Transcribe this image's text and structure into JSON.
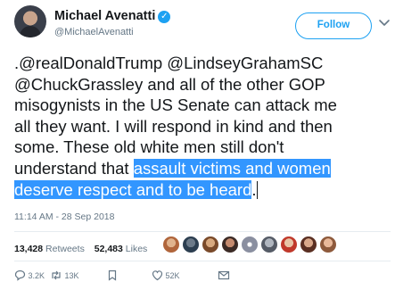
{
  "tweet": {
    "author": {
      "display_name": "Michael Avenatti",
      "handle": "@MichaelAvenatti",
      "verified_icon": "verified-badge-icon"
    },
    "follow_label": "Follow",
    "text_lines": [
      ".@realDonaldTrump @LindseyGrahamSC",
      "@ChuckGrassley and all of the other GOP",
      "misogynists in the US Senate can attack me",
      "all they want. I will respond in kind and then",
      "some. These old white men still don't"
    ],
    "line6_plain": "understand that ",
    "line6_highlight": "assault victims and women",
    "line7_highlight": "deserve respect and to be heard",
    "line7_tail": ".",
    "timestamp": "11:14 AM - 28 Sep 2018",
    "stats": {
      "retweets_count": "13,428",
      "retweets_label": "Retweets",
      "likes_count": "52,483",
      "likes_label": "Likes"
    },
    "actions": {
      "replies": "3.2K",
      "retweets": "13K",
      "likes": "52K"
    },
    "colors": {
      "accent": "#1da1f2",
      "selection": "#3296ff",
      "muted": "#657786"
    }
  }
}
